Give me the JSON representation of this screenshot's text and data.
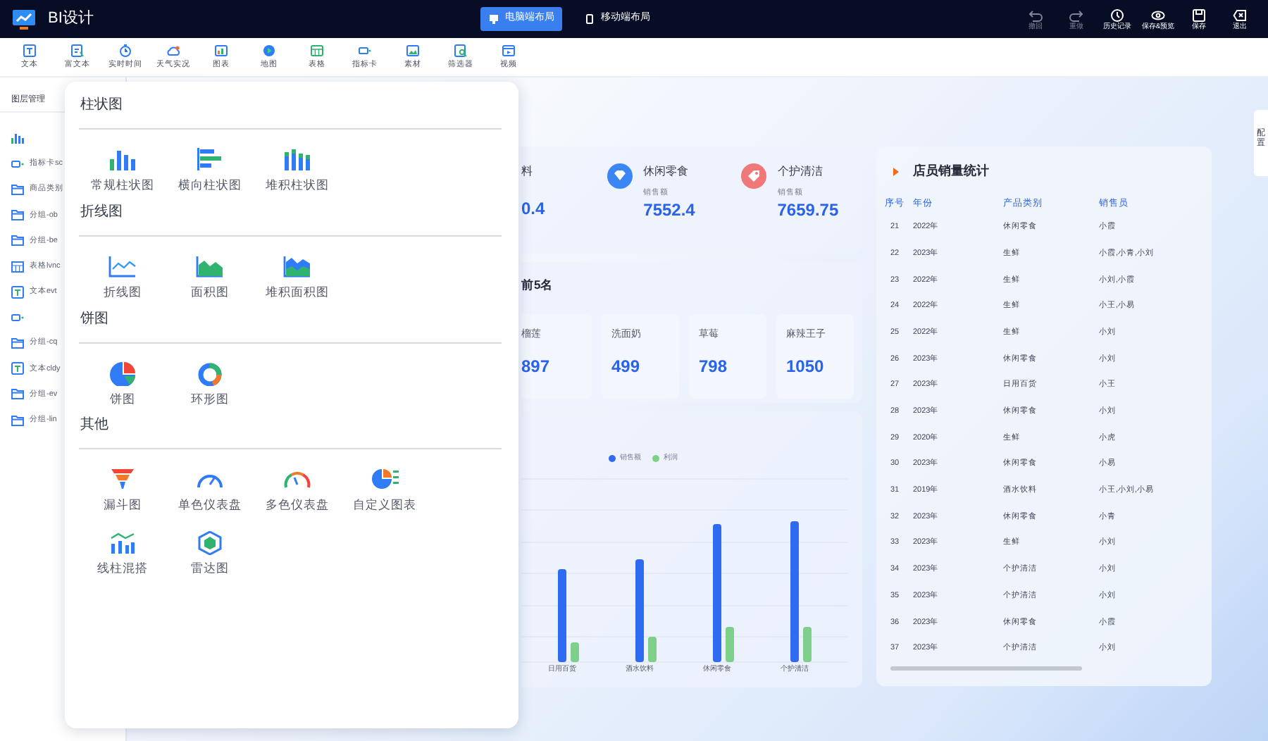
{
  "app": {
    "title": "BI设计"
  },
  "layout_modes": [
    {
      "label": "电脑端布局",
      "selected": true
    },
    {
      "label": "移动端布局",
      "selected": false
    }
  ],
  "actions": [
    {
      "label": "撤回",
      "disabled": true
    },
    {
      "label": "重做",
      "disabled": true
    },
    {
      "label": "历史记录",
      "disabled": false
    },
    {
      "label": "保存&预览",
      "disabled": false
    },
    {
      "label": "保存",
      "disabled": false
    },
    {
      "label": "退出",
      "disabled": false
    }
  ],
  "toolbar": [
    {
      "label": "文本"
    },
    {
      "label": "富文本"
    },
    {
      "label": "实时时间"
    },
    {
      "label": "天气实况"
    },
    {
      "label": "图表"
    },
    {
      "label": "地图"
    },
    {
      "label": "表格"
    },
    {
      "label": "指标卡"
    },
    {
      "label": "素材"
    },
    {
      "label": "筛选器"
    },
    {
      "label": "视频"
    }
  ],
  "layers": {
    "title": "图层管理",
    "items": [
      {
        "kind": "chart"
      },
      {
        "kind": "card",
        "label": "指标卡sc"
      },
      {
        "kind": "group",
        "label": "商品类别"
      },
      {
        "kind": "group",
        "label": "分组-ob"
      },
      {
        "kind": "group",
        "label": "分组-be"
      },
      {
        "kind": "table",
        "label": "表格lvnc"
      },
      {
        "kind": "text",
        "label": "文本evt"
      },
      {
        "kind": "card"
      },
      {
        "kind": "group",
        "label": "分组-cq"
      },
      {
        "kind": "text",
        "label": "文本cldy"
      },
      {
        "kind": "group",
        "label": "分组-ev"
      },
      {
        "kind": "group",
        "label": "分组-lin"
      }
    ]
  },
  "chart_picker": [
    {
      "title": "柱状图",
      "items": [
        "常规柱状图",
        "横向柱状图",
        "堆积柱状图"
      ]
    },
    {
      "title": "折线图",
      "items": [
        "折线图",
        "面积图",
        "堆积面积图"
      ]
    },
    {
      "title": "饼图",
      "items": [
        "饼图",
        "环形图"
      ]
    },
    {
      "title": "其他",
      "items": [
        "漏斗图",
        "单色仪表盘",
        "多色仪表盘",
        "自定义图表",
        "线柱混搭",
        "雷达图"
      ]
    }
  ],
  "metrics": [
    {
      "label": "料",
      "value": "0.4"
    },
    {
      "label": "休闲零食",
      "caption": "销售额",
      "value": "7552.4"
    },
    {
      "label": "个护清洁",
      "caption": "销售额",
      "value": "7659.75"
    }
  ],
  "top5": {
    "title": "前5名",
    "items": [
      {
        "label": "榴莲",
        "value": "897"
      },
      {
        "label": "洗面奶",
        "value": "499"
      },
      {
        "label": "草莓",
        "value": "798"
      },
      {
        "label": "麻辣王子",
        "value": "1050"
      }
    ]
  },
  "bar_chart": {
    "legend": [
      {
        "label": "销售额",
        "color": "#2f6bf0"
      },
      {
        "label": "利润",
        "color": "#7dcf8a"
      }
    ],
    "x_labels": [
      "日用百货",
      "酒水饮料",
      "休闲零食",
      "个护清洁"
    ]
  },
  "staff_table": {
    "title": "店员销量统计",
    "columns": [
      "序号",
      "年份",
      "产品类别",
      "销售员"
    ],
    "rows": [
      [
        "21",
        "2022年",
        "休闲零食",
        "小霞"
      ],
      [
        "22",
        "2023年",
        "生鲜",
        "小霞,小青,小刘"
      ],
      [
        "23",
        "2022年",
        "生鲜",
        "小刘,小霞"
      ],
      [
        "24",
        "2022年",
        "生鲜",
        "小王,小易"
      ],
      [
        "25",
        "2022年",
        "生鲜",
        "小刘"
      ],
      [
        "26",
        "2023年",
        "休闲零食",
        "小刘"
      ],
      [
        "27",
        "2023年",
        "日用百货",
        "小王"
      ],
      [
        "28",
        "2023年",
        "休闲零食",
        "小刘"
      ],
      [
        "29",
        "2020年",
        "生鲜",
        "小虎"
      ],
      [
        "30",
        "2023年",
        "休闲零食",
        "小易"
      ],
      [
        "31",
        "2019年",
        "酒水饮料",
        "小王,小刘,小易"
      ],
      [
        "32",
        "2023年",
        "休闲零食",
        "小青"
      ],
      [
        "33",
        "2023年",
        "生鲜",
        "小刘"
      ],
      [
        "34",
        "2023年",
        "个护清洁",
        "小刘"
      ],
      [
        "35",
        "2023年",
        "个护清洁",
        "小刘"
      ],
      [
        "36",
        "2023年",
        "休闲零食",
        "小霞"
      ],
      [
        "37",
        "2023年",
        "个护清洁",
        "小刘"
      ]
    ]
  },
  "side_tab": {
    "label": "配置"
  }
}
